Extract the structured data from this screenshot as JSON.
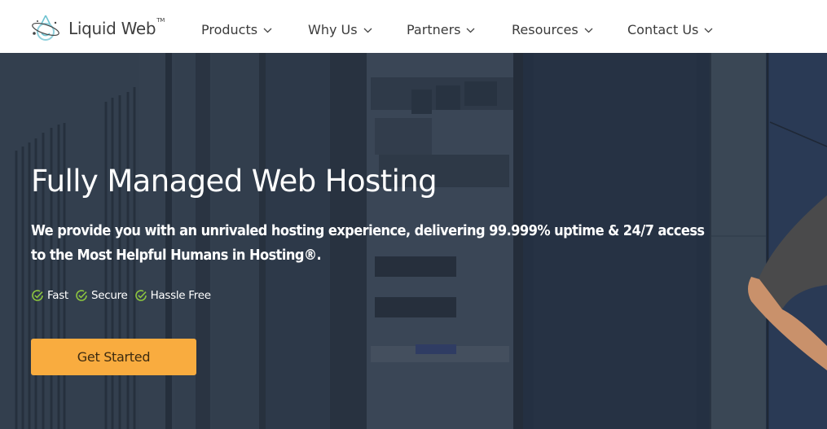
{
  "brand": {
    "name": "Liquid Web",
    "trademark": "TM",
    "logo_icon": "liquid-web-droplet-logo-icon"
  },
  "nav": {
    "items": [
      {
        "label": "Products",
        "icon": "chevron-down-icon"
      },
      {
        "label": "Why Us",
        "icon": "chevron-down-icon"
      },
      {
        "label": "Partners",
        "icon": "chevron-down-icon"
      },
      {
        "label": "Resources",
        "icon": "chevron-down-icon"
      },
      {
        "label": "Contact Us",
        "icon": "chevron-down-icon"
      }
    ]
  },
  "hero": {
    "title": "Fully Managed Web Hosting",
    "subtitle": "We provide you with an unrivaled hosting experience, delivering 99.999% uptime & 24/7 access to the Most Helpful Humans in Hosting®.",
    "features": [
      {
        "label": "Fast",
        "icon": "check-circle-icon"
      },
      {
        "label": "Secure",
        "icon": "check-circle-icon"
      },
      {
        "label": "Hassle Free",
        "icon": "check-circle-icon"
      }
    ],
    "cta_label": "Get Started",
    "background": "server-rack-photo with person",
    "colors": {
      "cta": "#f9ac3f",
      "check": "#8dc63f",
      "overlay": "#2c3848"
    }
  }
}
